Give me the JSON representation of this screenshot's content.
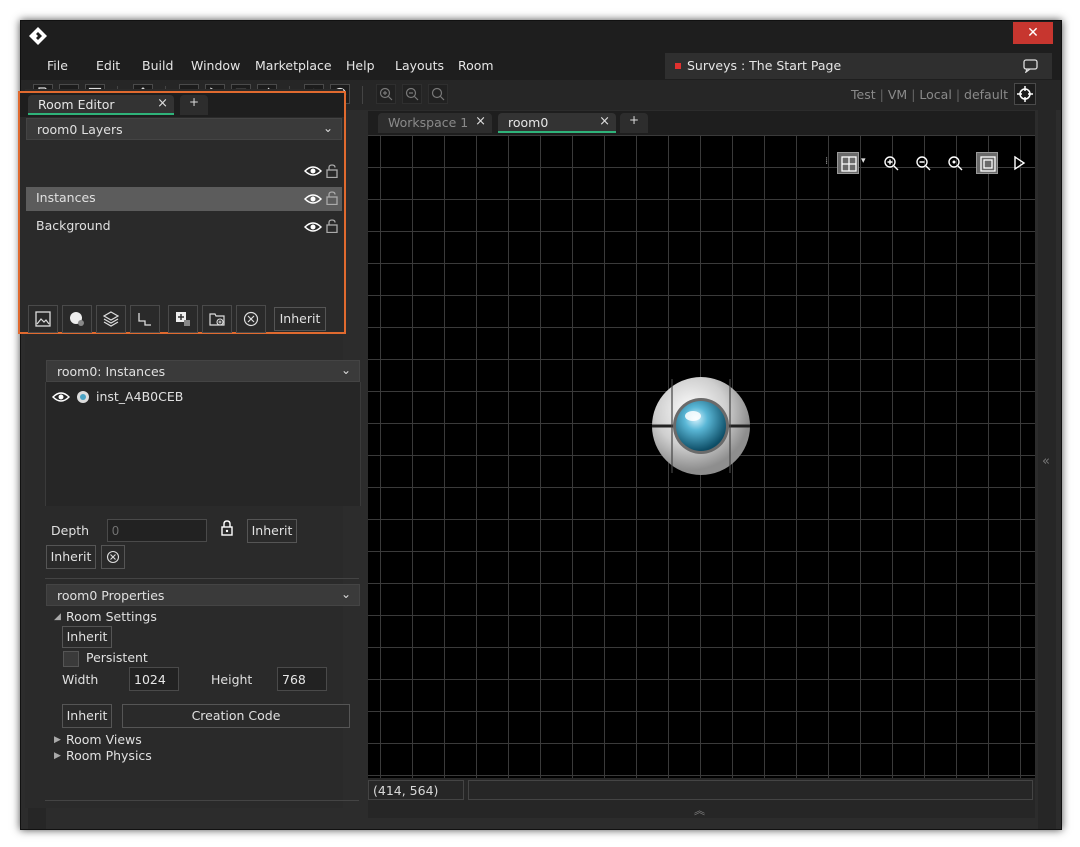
{
  "window": {
    "close_label": "✕"
  },
  "menu": {
    "items": [
      "File",
      "Edit",
      "Build",
      "Window",
      "Marketplace",
      "Help",
      "Layouts",
      "Room"
    ]
  },
  "survey": {
    "text": "Surveys : The Start Page"
  },
  "targets": {
    "items": [
      "Test",
      "VM",
      "Local",
      "default"
    ]
  },
  "editor": {
    "tab_label": "Room Editor",
    "tab_close": "×",
    "tab_add": "+",
    "layers_header": "room0 Layers",
    "layers": [
      {
        "label": "Instances",
        "selected": true
      },
      {
        "label": "Background",
        "selected": false
      }
    ],
    "inherit_label": "Inherit"
  },
  "instances": {
    "header": "room0: Instances",
    "items": [
      "inst_A4B0CEB"
    ],
    "depth_label": "Depth",
    "depth_placeholder": "0",
    "inherit_label": "Inherit",
    "inherit2_label": "Inherit"
  },
  "properties": {
    "header": "room0 Properties",
    "room_settings": "Room Settings",
    "inherit_label": "Inherit",
    "persistent_label": "Persistent",
    "width_label": "Width",
    "width_value": "1024",
    "height_label": "Height",
    "height_value": "768",
    "inherit2_label": "Inherit",
    "creation_code_label": "Creation Code",
    "room_views": "Room Views",
    "room_physics": "Room Physics"
  },
  "workspace": {
    "tabs": [
      {
        "label": "Workspace 1",
        "active": false
      },
      {
        "label": "room0",
        "active": true
      }
    ],
    "tab_close": "×",
    "tab_add": "+",
    "coords": "(414, 564)"
  },
  "colors": {
    "accent": "#e06a2f",
    "tab_active": "#2fb37a",
    "close": "#c7362f"
  },
  "icons": [
    "app-logo-icon",
    "new-icon",
    "open-icon",
    "save-icon",
    "export-icon",
    "debug-icon",
    "run-icon",
    "stop-icon",
    "clean-icon",
    "settings-icon",
    "help-icon",
    "zoom-in-icon",
    "zoom-out-icon",
    "zoom-reset-icon",
    "target-icon",
    "eye-icon",
    "lock-icon",
    "chat-icon",
    "arrow-icon"
  ]
}
